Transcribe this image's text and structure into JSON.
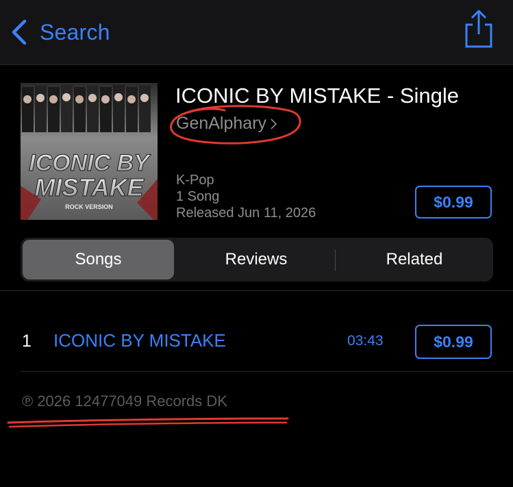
{
  "nav": {
    "back_label": "Search",
    "back_icon": "chevron-left-icon",
    "share_icon": "share-icon",
    "accent_color": "#3a82f7"
  },
  "album": {
    "title": "ICONIC BY MISTAKE - Single",
    "artist": "GenAlphary",
    "genre": "K-Pop",
    "song_count": "1 Song",
    "released": "Released Jun 11, 2026",
    "price": "$0.99",
    "cover_text_line1": "ICONIC BY",
    "cover_text_line2": "MISTAKE",
    "cover_text_line3": "ROCK VERSION"
  },
  "tabs": [
    {
      "label": "Songs",
      "selected": true
    },
    {
      "label": "Reviews",
      "selected": false
    },
    {
      "label": "Related",
      "selected": false
    }
  ],
  "tracks": [
    {
      "number": "1",
      "title": "ICONIC BY MISTAKE",
      "duration": "03:43",
      "price": "$0.99"
    }
  ],
  "copyright": "℗ 2026 12477049 Records DK",
  "annotations": {
    "marker_color": "#e03a2f"
  }
}
